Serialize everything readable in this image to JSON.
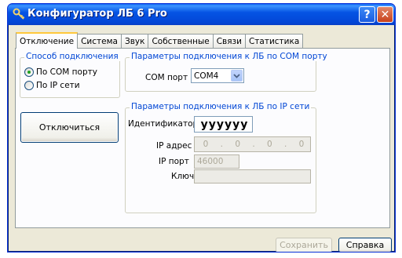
{
  "window": {
    "title": "Конфигуратор ЛБ 6 Pro"
  },
  "tabs": [
    "Отключение",
    "Система",
    "Звук",
    "Собственные",
    "Связи",
    "Статистика"
  ],
  "connection_method": {
    "legend": "Способ подключения",
    "options": [
      {
        "label": "По COM порту",
        "selected": true
      },
      {
        "label": "По IP сети",
        "selected": false
      }
    ]
  },
  "com_params": {
    "legend": "Параметры подключения к ЛБ по COM порту",
    "port_label": "COM порт",
    "port_value": "COM4"
  },
  "disconnect_button": "Отключиться",
  "ip_params": {
    "legend": "Параметры подключения к ЛБ по IP сети",
    "identifier_label": "Идентификатор",
    "identifier_value": "yyyyyy",
    "ip_address_label": "IP адрес",
    "ip_octets": [
      "0",
      "0",
      "0",
      "0"
    ],
    "ip_separator": ".",
    "ip_port_label": "IP порт",
    "ip_port_value": "46000",
    "key_label": "Ключ",
    "key_value": ""
  },
  "footer": {
    "save_label": "Сохранить",
    "help_label": "Справка"
  },
  "titlebar_buttons": {
    "help": "?",
    "close": "✕"
  },
  "colors": {
    "accent": "#0046d5",
    "titlebar": "#0554e4",
    "close": "#c8411b"
  },
  "icons": {
    "app": "key-icon",
    "dropdown": "chevron-down-icon"
  }
}
